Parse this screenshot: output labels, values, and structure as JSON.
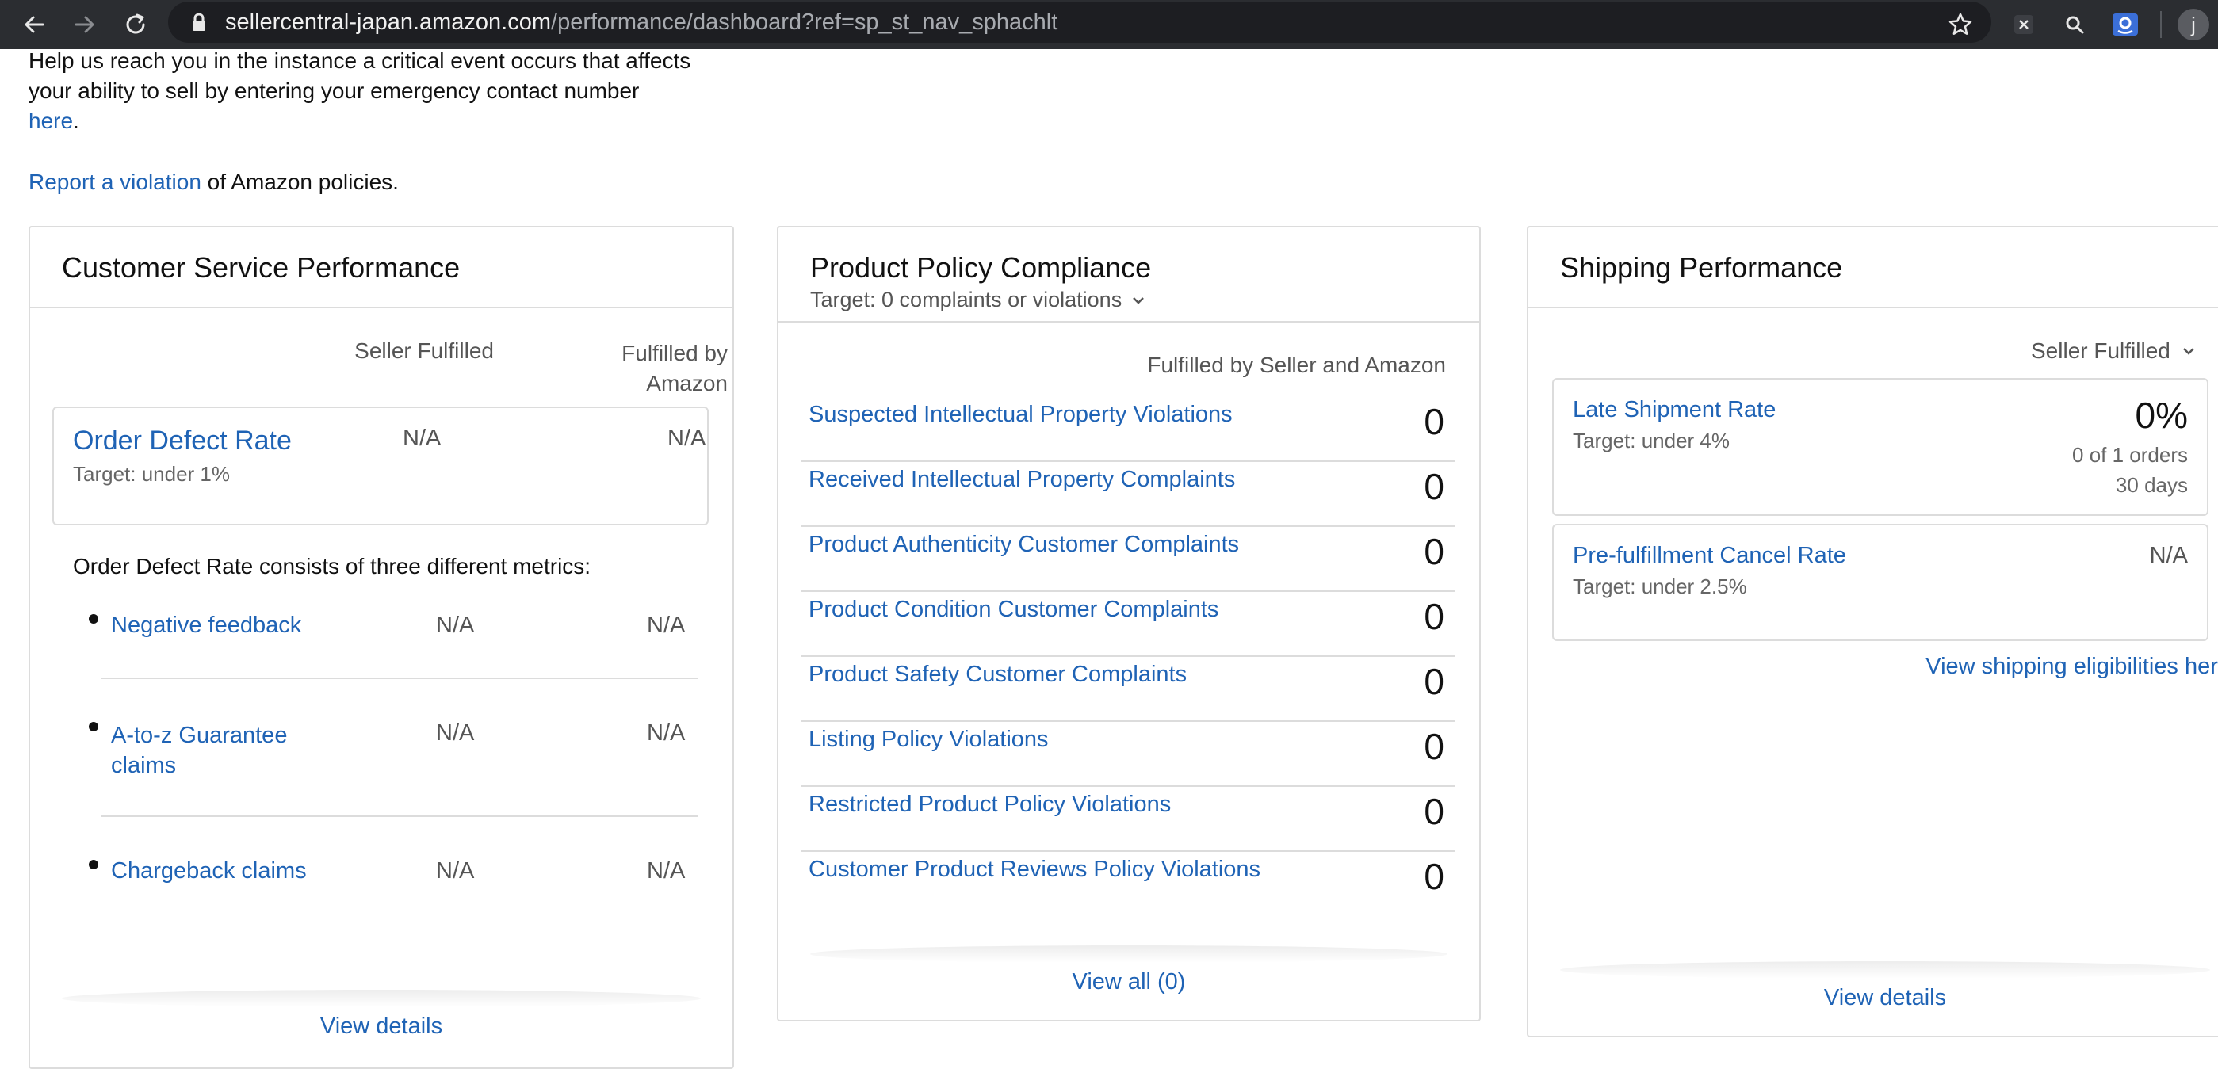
{
  "browser": {
    "url_host": "sellercentral-japan.amazon.com",
    "url_path": "/performance/dashboard?ref=sp_st_nav_sphachlt",
    "profile_initial": "j"
  },
  "intro": {
    "line1": "Help us reach you in the instance a critical event occurs that affects",
    "line2": "your ability to sell by entering your emergency contact number",
    "here_link": "here",
    "period": ".",
    "report_link": "Report a violation",
    "report_suffix": " of Amazon policies."
  },
  "customer_service": {
    "title": "Customer Service Performance",
    "col_seller": "Seller Fulfilled",
    "col_amazon_1": "Fulfilled by",
    "col_amazon_2": "Amazon",
    "odr_label": "Order Defect Rate",
    "odr_target": "Target: under 1%",
    "odr_seller": "N/A",
    "odr_amazon": "N/A",
    "consists_text": "Order Defect Rate consists of three different metrics:",
    "metrics": [
      {
        "label": "Negative feedback",
        "seller": "N/A",
        "amazon": "N/A"
      },
      {
        "label": "A-to-z Guarantee claims",
        "seller": "N/A",
        "amazon": "N/A"
      },
      {
        "label": "Chargeback claims",
        "seller": "N/A",
        "amazon": "N/A"
      }
    ],
    "metric_az_line1": "A-to-z Guarantee",
    "metric_az_line2": "claims",
    "view_details": "View details"
  },
  "product_policy": {
    "title": "Product Policy Compliance",
    "target": "Target: 0 complaints or violations",
    "column_header": "Fulfilled by Seller and Amazon",
    "rows": [
      {
        "label": "Suspected Intellectual Property Violations",
        "value": "0"
      },
      {
        "label": "Received Intellectual Property Complaints",
        "value": "0"
      },
      {
        "label": "Product Authenticity Customer Complaints",
        "value": "0"
      },
      {
        "label": "Product Condition Customer Complaints",
        "value": "0"
      },
      {
        "label": "Product Safety Customer Complaints",
        "value": "0"
      },
      {
        "label": "Listing Policy Violations",
        "value": "0"
      },
      {
        "label": "Restricted Product Policy Violations",
        "value": "0"
      },
      {
        "label": "Customer Product Reviews Policy Violations",
        "value": "0"
      }
    ],
    "view_all": "View all (0)"
  },
  "shipping": {
    "title": "Shipping Performance",
    "filter": "Seller Fulfilled",
    "late_label": "Late Shipment Rate",
    "late_target": "Target: under 4%",
    "late_value": "0%",
    "late_orders": "0 of 1 orders",
    "late_days": "30 days",
    "cancel_label": "Pre-fulfillment Cancel Rate",
    "cancel_target": "Target: under 2.5%",
    "cancel_value": "N/A",
    "eligibility_link": "View shipping eligibilities here",
    "view_details": "View details"
  },
  "colors": {
    "link": "#1f63b5",
    "chrome_bg": "#2b2d31"
  }
}
